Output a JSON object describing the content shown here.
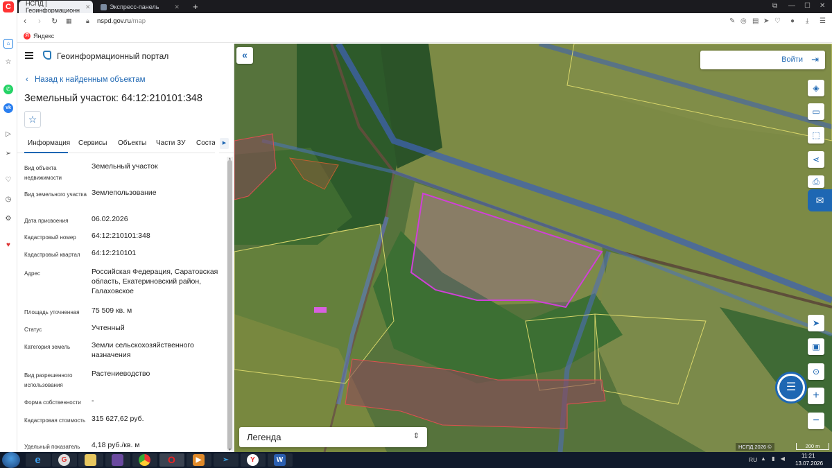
{
  "browser": {
    "tabs": [
      {
        "title": "НСПД | Геоинформационн",
        "active": true
      },
      {
        "title": "Экспресс-панель",
        "active": false
      }
    ],
    "url_host": "nspd.gov.ru",
    "url_path": "/map",
    "bookmark": "Яндекс"
  },
  "panel": {
    "portal_title": "Геоинформационный портал",
    "back_link": "Назад к найденным объектам",
    "object_title": "Земельный участок: 64:12:210101:348",
    "tabs": [
      "Информация",
      "Сервисы",
      "Объекты",
      "Части ЗУ",
      "Состав"
    ],
    "properties": [
      {
        "label": "Вид объекта недвижимости",
        "value": "Земельный участок"
      },
      {
        "label": "Вид земельного участка",
        "value": "Землепользование"
      },
      {
        "label": "Дата присвоения",
        "value": "06.02.2026"
      },
      {
        "label": "Кадастровый номер",
        "value": "64:12:210101:348"
      },
      {
        "label": "Кадастровый квартал",
        "value": "64:12:210101"
      },
      {
        "label": "Адрес",
        "value": "Российская Федерация, Саратовская область, Екатериновский район, Галаховское"
      },
      {
        "label": "Площадь уточненная",
        "value": "75 509 кв. м"
      },
      {
        "label": "Статус",
        "value": "Учтенный"
      },
      {
        "label": "Категория земель",
        "value": "Земли сельскохозяйственного назначения"
      },
      {
        "label": "Вид разрешенного использования",
        "value": "Растениеводство"
      },
      {
        "label": "Форма собственности",
        "value": "-"
      },
      {
        "label": "Кадастровая стоимость",
        "value": "315 627,62 руб."
      },
      {
        "label": "Удельный показатель",
        "value": "4,18 руб./кв. м"
      }
    ]
  },
  "map": {
    "login_label": "Войти",
    "legend_label": "Легенда",
    "attribution": "НСПД 2026 ©",
    "scale": "200 m",
    "controls": [
      "layers-icon",
      "ruler-icon",
      "select-area-icon",
      "share-icon",
      "print-icon",
      "locate-icon",
      "minimap-icon",
      "geo-search-icon",
      "zoom-in-icon",
      "zoom-out-icon"
    ]
  },
  "taskbar": {
    "lang": "RU",
    "time": "11:21",
    "date": "13.07.2026"
  }
}
